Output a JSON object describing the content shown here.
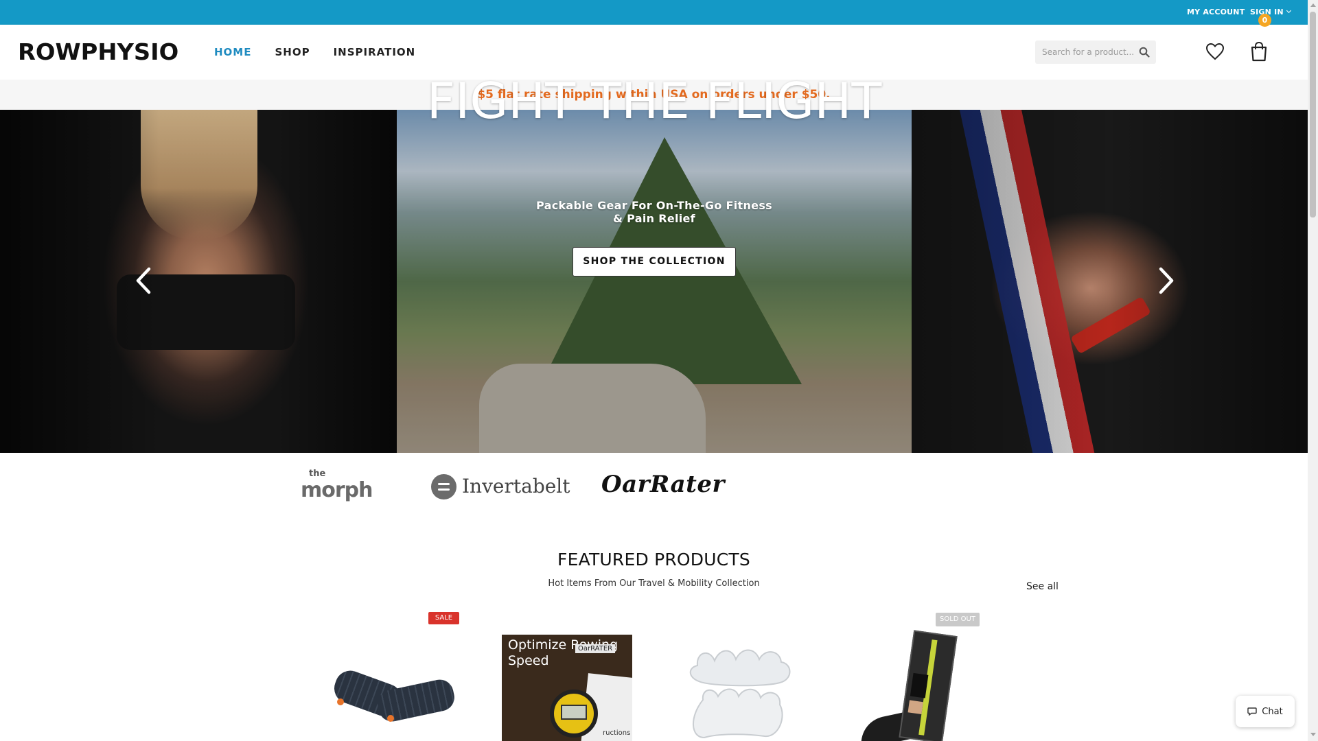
{
  "topbar": {
    "my_account": "MY ACCOUNT",
    "sign_in": "SIGN IN"
  },
  "header": {
    "logo": "ROWPHYSIO",
    "nav": [
      {
        "label": "HOME",
        "active": true
      },
      {
        "label": "SHOP",
        "active": false
      },
      {
        "label": "INSPIRATION",
        "active": false
      }
    ],
    "search_placeholder": "Search for a product...",
    "cart_count": "0"
  },
  "promo": {
    "text": "$5 flat rate shipping within USA on orders under $50."
  },
  "hero": {
    "title": "FIGHT THE FLIGHT",
    "subtitle": "Packable Gear For On-The-Go Fitness & Pain Relief",
    "cta": "SHOP THE COLLECTION"
  },
  "brands": {
    "morph_the": "the",
    "morph": "morph",
    "invertabelt": "Invertabelt",
    "oarrater": "OarRater"
  },
  "featured": {
    "title": "FEATURED PRODUCTS",
    "subtitle": "Hot Items From Our Travel & Mobility Collection",
    "see_all": "See all",
    "sale_badge": "SALE",
    "sold_out_badge": "SOLD OUT",
    "oarrater_box_title": "Optimize Rowing Speed",
    "oarrater_box_label": "OarRATER",
    "oarrater_box_text": "ructions"
  },
  "chat": {
    "label": "Chat"
  },
  "colors": {
    "topbar": "#1499c6",
    "nav_active": "#1f8bc0",
    "promo_text": "#e36a1f",
    "sale": "#d9332b",
    "cart_badge": "#f5a623"
  },
  "icons": [
    "chevron-down-icon",
    "search-icon",
    "heart-icon",
    "cart-icon",
    "arrow-left-icon",
    "arrow-right-icon",
    "chat-icon"
  ]
}
